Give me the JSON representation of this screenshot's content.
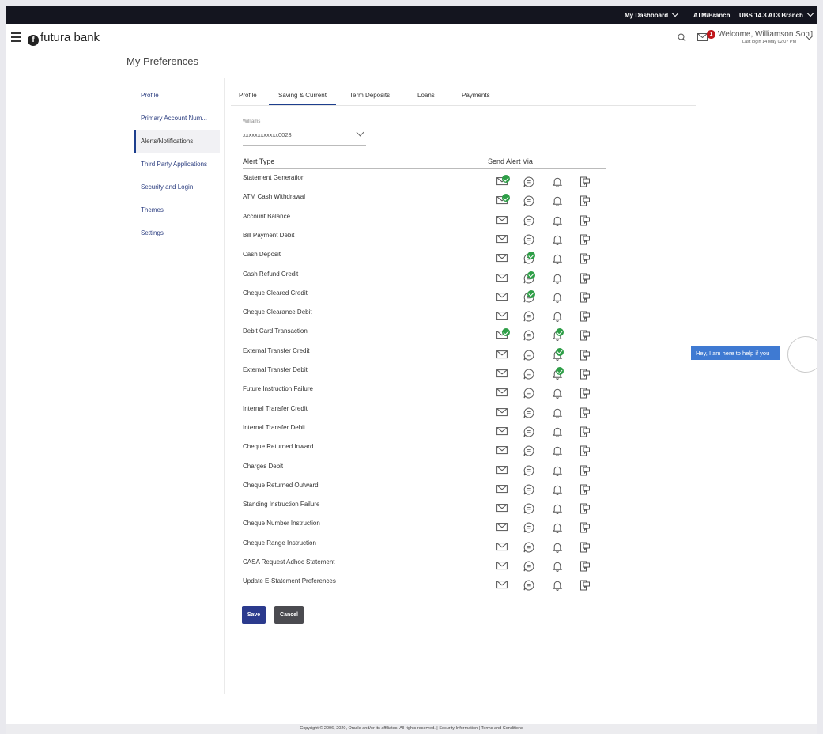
{
  "topbar": {
    "dashboard": "My Dashboard",
    "atm_branch": "ATM/Branch",
    "branch": "UBS 14.3 AT3 Branch"
  },
  "header": {
    "brand": "futura bank",
    "brand_mark": "f",
    "mail_badge": "1",
    "welcome": "Welcome, Williamson Son1",
    "last_login": "Last login 14 May 02:07 PM"
  },
  "page": {
    "title": "My Preferences"
  },
  "sidebar": {
    "items": [
      {
        "label": "Profile",
        "active": false
      },
      {
        "label": "Primary Account Num...",
        "active": false
      },
      {
        "label": "Alerts/Notifications",
        "active": true
      },
      {
        "label": "Third Party Applications",
        "active": false
      },
      {
        "label": "Security and Login",
        "active": false
      },
      {
        "label": "Themes",
        "active": false
      },
      {
        "label": "Settings",
        "active": false
      }
    ]
  },
  "tabs": [
    {
      "label": "Profile",
      "active": false
    },
    {
      "label": "Saving & Current",
      "active": true
    },
    {
      "label": "Term Deposits",
      "active": false
    },
    {
      "label": "Loans",
      "active": false
    },
    {
      "label": "Payments",
      "active": false
    }
  ],
  "account": {
    "label": "Williams",
    "value": "xxxxxxxxxxxx0023"
  },
  "alerts": {
    "header_type": "Alert Type",
    "header_via": "Send Alert Via",
    "channels": [
      "email-icon",
      "sms-icon",
      "bell-icon",
      "push-icon"
    ],
    "rows": [
      {
        "type": "Statement Generation",
        "email": true,
        "sms": false,
        "bell": false,
        "push": false
      },
      {
        "type": "ATM Cash Withdrawal",
        "email": true,
        "sms": false,
        "bell": false,
        "push": false
      },
      {
        "type": "Account Balance",
        "email": false,
        "sms": false,
        "bell": false,
        "push": false
      },
      {
        "type": "Bill Payment Debit",
        "email": false,
        "sms": false,
        "bell": false,
        "push": false
      },
      {
        "type": "Cash Deposit",
        "email": false,
        "sms": true,
        "bell": false,
        "push": false
      },
      {
        "type": "Cash Refund Credit",
        "email": false,
        "sms": true,
        "bell": false,
        "push": false
      },
      {
        "type": "Cheque Cleared Credit",
        "email": false,
        "sms": true,
        "bell": false,
        "push": false
      },
      {
        "type": "Cheque Clearance Debit",
        "email": false,
        "sms": false,
        "bell": false,
        "push": false
      },
      {
        "type": "Debit Card Transaction",
        "email": true,
        "sms": false,
        "bell": true,
        "push": false
      },
      {
        "type": "External Transfer Credit",
        "email": false,
        "sms": false,
        "bell": true,
        "push": false
      },
      {
        "type": "External Transfer Debit",
        "email": false,
        "sms": false,
        "bell": true,
        "push": false
      },
      {
        "type": "Future Instruction Failure",
        "email": false,
        "sms": false,
        "bell": false,
        "push": false
      },
      {
        "type": "Internal Transfer Credit",
        "email": false,
        "sms": false,
        "bell": false,
        "push": false
      },
      {
        "type": "Internal Transfer Debit",
        "email": false,
        "sms": false,
        "bell": false,
        "push": false
      },
      {
        "type": "Cheque Returned Inward",
        "email": false,
        "sms": false,
        "bell": false,
        "push": false
      },
      {
        "type": "Charges Debit",
        "email": false,
        "sms": false,
        "bell": false,
        "push": false
      },
      {
        "type": "Cheque Returned Outward",
        "email": false,
        "sms": false,
        "bell": false,
        "push": false
      },
      {
        "type": "Standing Instruction Failure",
        "email": false,
        "sms": false,
        "bell": false,
        "push": false
      },
      {
        "type": "Cheque Number Instruction",
        "email": false,
        "sms": false,
        "bell": false,
        "push": false
      },
      {
        "type": "Cheque Range Instruction",
        "email": false,
        "sms": false,
        "bell": false,
        "push": false
      },
      {
        "type": "CASA Request Adhoc Statement",
        "email": false,
        "sms": false,
        "bell": false,
        "push": false
      },
      {
        "type": "Update E-Statement Preferences",
        "email": false,
        "sms": false,
        "bell": false,
        "push": false
      }
    ]
  },
  "actions": {
    "save": "Save",
    "cancel": "Cancel"
  },
  "chatbot": {
    "message": "Hey, I am here to help if you"
  },
  "footer": {
    "text": "Copyright © 2006, 2020, Oracle and/or its affiliates. All rights reserved. | Security Information | Terms and Conditions"
  },
  "colors": {
    "topbar": "#14151f",
    "primary": "#2b3a8d",
    "check": "#2e9e47",
    "badge": "#c0171c",
    "chatbot": "#3f7ad2"
  }
}
